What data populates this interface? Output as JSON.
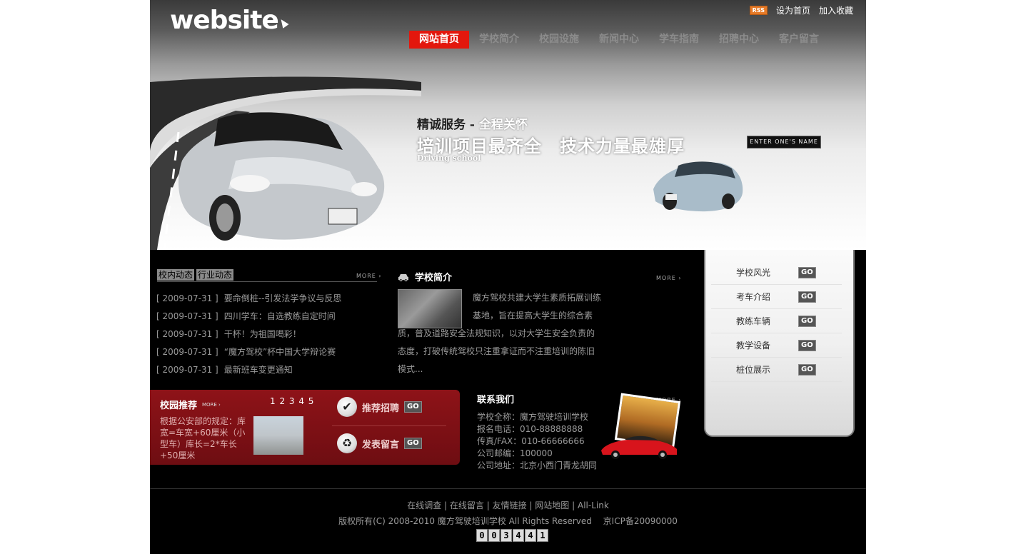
{
  "header": {
    "logo_text": "website",
    "rss_label": "RSS",
    "set_home": "设为首页",
    "add_favorite": "加入收藏",
    "nav": [
      {
        "label": "网站首页",
        "active": true
      },
      {
        "label": "学校简介",
        "active": false
      },
      {
        "label": "校园设施",
        "active": false
      },
      {
        "label": "新闻中心",
        "active": false
      },
      {
        "label": "学车指南",
        "active": false
      },
      {
        "label": "招聘中心",
        "active": false
      },
      {
        "label": "客户留言",
        "active": false
      }
    ]
  },
  "banner": {
    "slogan_dark": "精诚服务 -",
    "slogan_light": "全程关怀",
    "headline": "培训项目最齐全　技术力量最雄厚",
    "subline": "Driving school",
    "enter_button": "ENTER ONE'S NAME ⟶"
  },
  "news": {
    "tab1": "校内动态",
    "tab2": "行业动态",
    "more": "MORE ›",
    "items": [
      {
        "date": "[ 2009-07-31 ]",
        "title": "要命倒桩--引发法学争议与反思"
      },
      {
        "date": "[ 2009-07-31 ]",
        "title": "四川学车：自选教练自定时间"
      },
      {
        "date": "[ 2009-07-31 ]",
        "title": "干杯！为祖国喝彩！"
      },
      {
        "date": "[ 2009-07-31 ]",
        "title": "“魔方驾校”杯中国大学辩论赛"
      },
      {
        "date": "[ 2009-07-31 ]",
        "title": "最新班车变更通知"
      }
    ]
  },
  "about": {
    "title": "学校简介",
    "more": "MORE ›",
    "text": "魔方驾校共建大学生素质拓展训练基地，旨在提高大学生的综合素质，普及道路安全法规知识，以对大学生安全负责的态度，打破传统驾校只注重拿证而不注重培训的陈旧模式..."
  },
  "recommend": {
    "title": "校园推荐",
    "more": "MORE ›",
    "pages": "1 2 3 4 5",
    "text": "根据公安部的规定：库宽=车宽+60厘米（小型车）库长=2*车长+50厘米",
    "btn1": "推荐招聘",
    "btn2": "发表留言",
    "go": "GO"
  },
  "contact": {
    "title": "联系我们",
    "more": "MORE ›",
    "lines": {
      "name": "学校全称：魔方驾驶培训学校",
      "phone": "报名电话：010-88888888",
      "fax": "传真/FAX：010-66666666",
      "zip": "公司邮编：100000",
      "address": "公司地址：北京小西门青龙胡同"
    }
  },
  "sidebar": {
    "items": [
      {
        "label": "学校风光",
        "go": "GO"
      },
      {
        "label": "考车介绍",
        "go": "GO"
      },
      {
        "label": "教练车辆",
        "go": "GO"
      },
      {
        "label": "教学设备",
        "go": "GO"
      },
      {
        "label": "桩位展示",
        "go": "GO"
      }
    ]
  },
  "footer": {
    "links": [
      "在线调查",
      "在线留言",
      "友情链接",
      "网站地图",
      "All-Link"
    ],
    "copyright": "版权所有(C) 2008-2010 魔方驾驶培训学校 All Rights Reserved　 京ICP备20090000",
    "counter": [
      "0",
      "0",
      "3",
      "4",
      "4",
      "1"
    ]
  }
}
